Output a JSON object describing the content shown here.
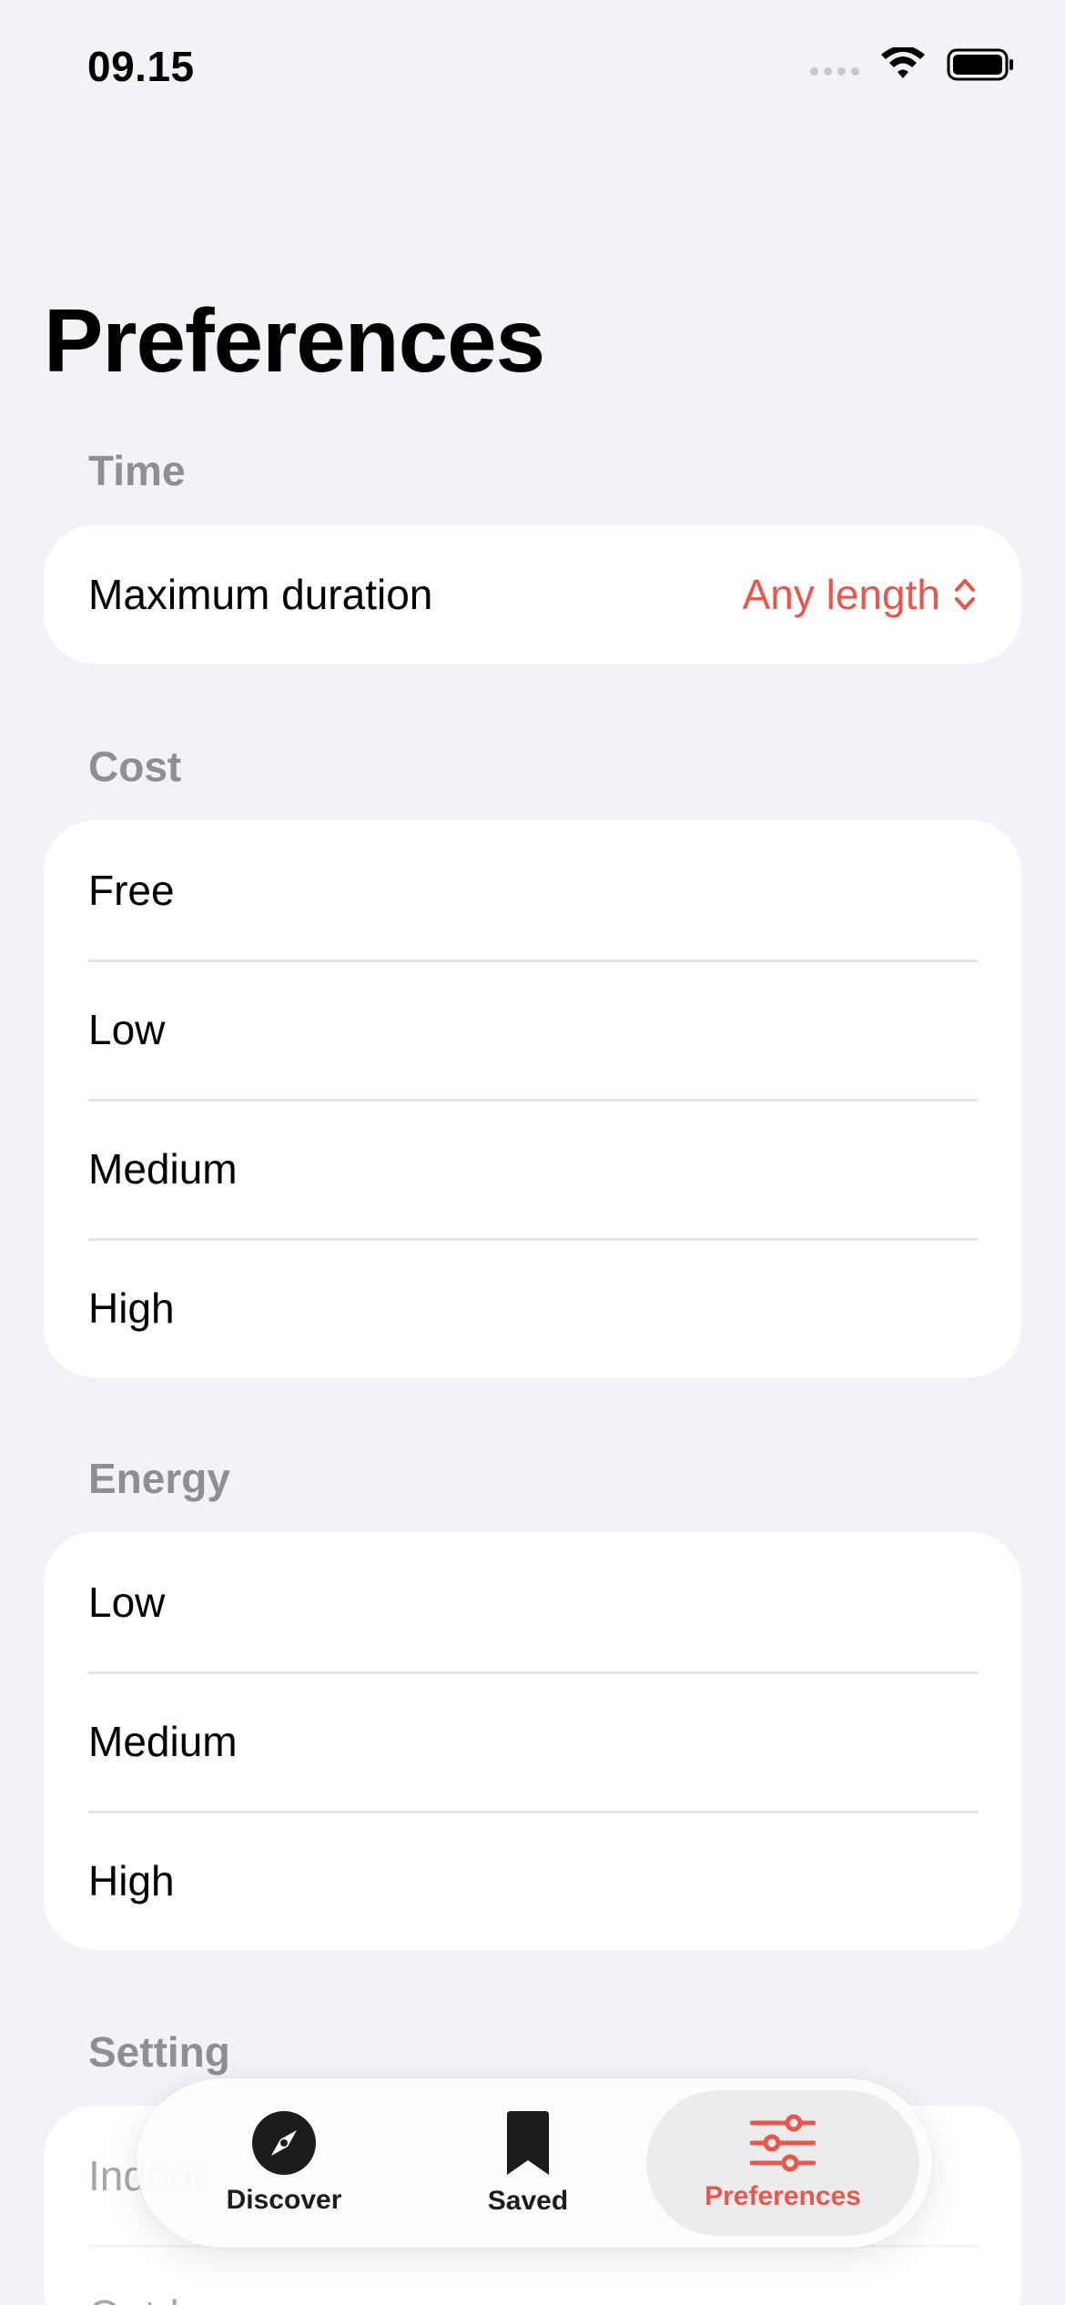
{
  "status_bar": {
    "time": "09.15"
  },
  "page_title": "Preferences",
  "sections": {
    "time": {
      "header": "Time",
      "max_duration_label": "Maximum duration",
      "max_duration_value": "Any length"
    },
    "cost": {
      "header": "Cost",
      "items": [
        "Free",
        "Low",
        "Medium",
        "High"
      ]
    },
    "energy": {
      "header": "Energy",
      "items": [
        "Low",
        "Medium",
        "High"
      ]
    },
    "setting": {
      "header": "Setting",
      "items": [
        "Indoor",
        "Outdoor"
      ]
    }
  },
  "tab_bar": {
    "tabs": [
      {
        "label": "Discover",
        "icon": "compass-icon"
      },
      {
        "label": "Saved",
        "icon": "bookmark-icon"
      },
      {
        "label": "Preferences",
        "icon": "sliders-icon"
      }
    ],
    "active_tab": "Preferences"
  },
  "colors": {
    "accent": "#e8574c",
    "background": "#f2f2f7",
    "card": "#ffffff",
    "section_header": "#8e8e93"
  }
}
